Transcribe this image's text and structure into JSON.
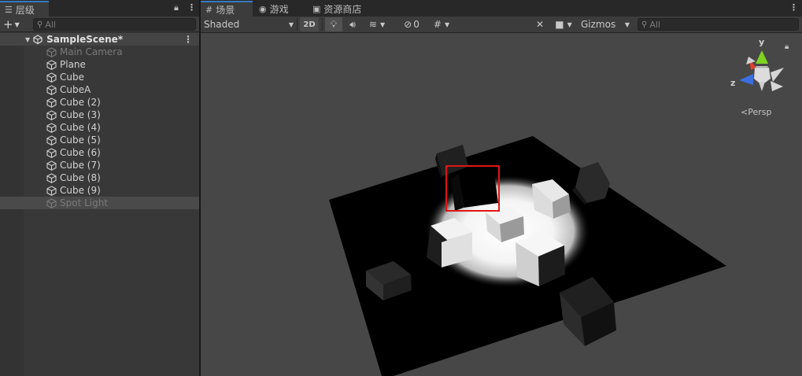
{
  "hierarchy": {
    "tab_label": "层级",
    "search_placeholder": "All",
    "scene_name": "SampleScene*",
    "objects": [
      {
        "name": "Main Camera",
        "disabled": true
      },
      {
        "name": "Plane",
        "disabled": false
      },
      {
        "name": "Cube",
        "disabled": false
      },
      {
        "name": "CubeA",
        "disabled": false
      },
      {
        "name": "Cube (2)",
        "disabled": false
      },
      {
        "name": "Cube (3)",
        "disabled": false
      },
      {
        "name": "Cube (4)",
        "disabled": false
      },
      {
        "name": "Cube (5)",
        "disabled": false
      },
      {
        "name": "Cube (6)",
        "disabled": false
      },
      {
        "name": "Cube (7)",
        "disabled": false
      },
      {
        "name": "Cube (8)",
        "disabled": false
      },
      {
        "name": "Cube (9)",
        "disabled": false
      },
      {
        "name": "Spot Light",
        "disabled": true
      }
    ]
  },
  "scene_tabs": [
    {
      "label": "场景",
      "icon": "grid-icon"
    },
    {
      "label": "游戏",
      "icon": "gamepad-icon"
    },
    {
      "label": "资源商店",
      "icon": "shopping-bag-icon"
    }
  ],
  "scene_toolbar": {
    "shading_mode": "Shaded",
    "mode_2d": "2D",
    "hidden_count": "0",
    "gizmos_label": "Gizmos",
    "search_placeholder": "All"
  },
  "scene_gizmo": {
    "y_label": "y",
    "z_label": "z",
    "projection": "Persp"
  },
  "colors": {
    "accent_blue": "#3a79bb",
    "selection_red": "#e01515",
    "axis_x": "#e0402a",
    "axis_y": "#7ed321",
    "axis_z": "#3b6fe0"
  }
}
